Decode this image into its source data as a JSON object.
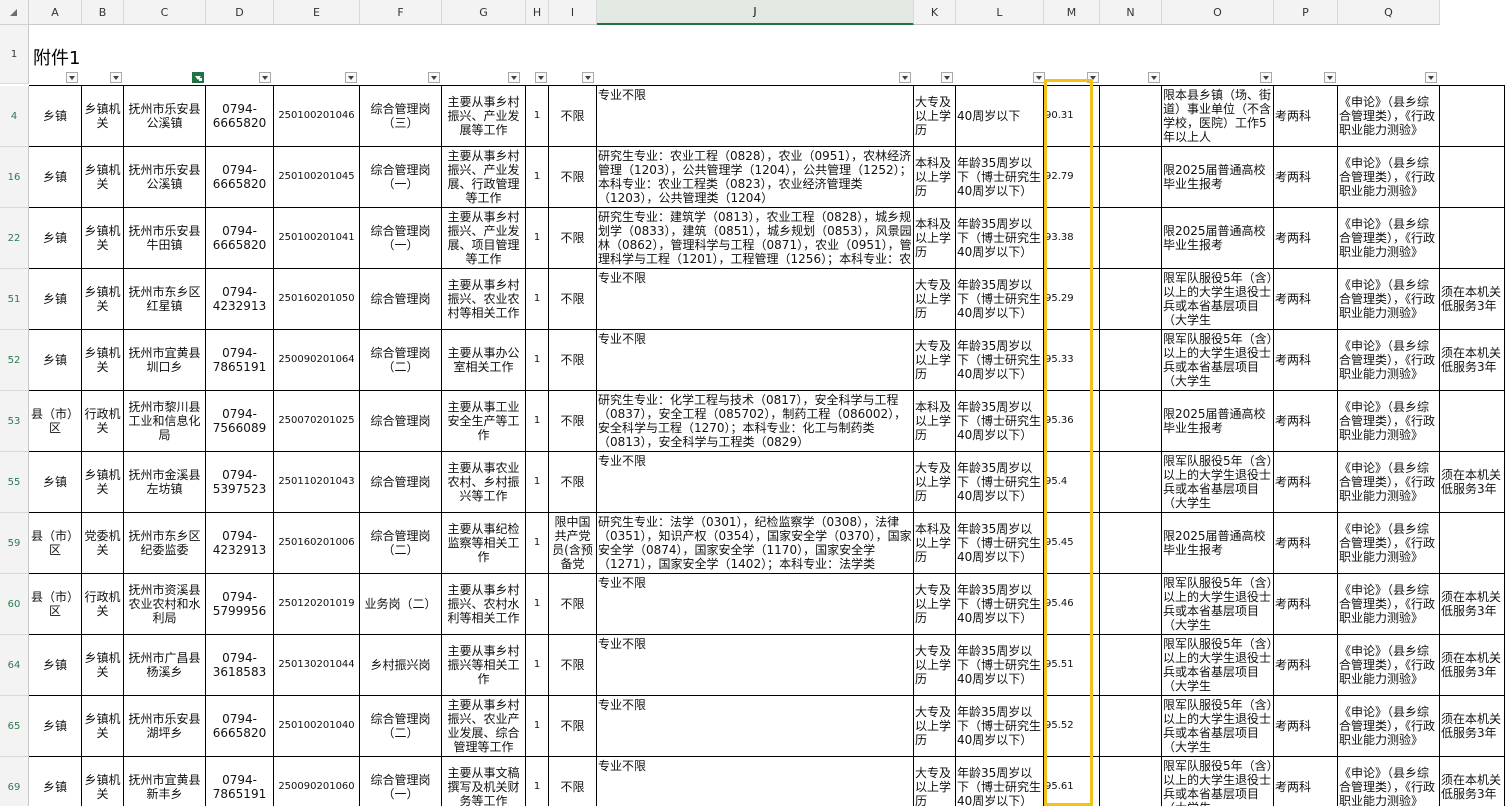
{
  "title": "附件1",
  "columns": [
    "A",
    "B",
    "C",
    "D",
    "E",
    "F",
    "G",
    "H",
    "I",
    "J",
    "K",
    "L",
    "M",
    "N",
    "O",
    "P",
    "Q"
  ],
  "rows": [
    {
      "num": "4",
      "level": "乡镇",
      "type": "乡镇机关",
      "unit": "抚州市乐安县公溪镇",
      "phone": "0794-6665820",
      "code": "250100201046",
      "post": "综合管理岗（三）",
      "duty": "主要从事乡村振兴、产业发展等工作",
      "count": "1",
      "politics": "不限",
      "major": "专业不限",
      "edu": "大专及以上学历",
      "age": "40周岁以下",
      "score": "90.31",
      "other": "限本县乡镇（场、街道）事业单位（不含学校，医院）工作5年以上人",
      "exam": "考两科",
      "subj": "《申论》（县乡综合管理类），《行政职业能力测验》",
      "note": ""
    },
    {
      "num": "16",
      "level": "乡镇",
      "type": "乡镇机关",
      "unit": "抚州市乐安县公溪镇",
      "phone": "0794-6665820",
      "code": "250100201045",
      "post": "综合管理岗（一）",
      "duty": "主要从事乡村振兴、产业发展、行政管理等工作",
      "count": "1",
      "politics": "不限",
      "major": "研究生专业：农业工程（0828），农业（0951），农林经济管理（1203），公共管理学（1204），公共管理（1252）；本科专业：农业工程类（0823），农业经济管理类（1203），公共管理类（1204）",
      "edu": "本科及以上学历",
      "age": "年龄35周岁以下（博士研究生40周岁以下）",
      "score": "92.79",
      "other": "限2025届普通高校毕业生报考",
      "exam": "考两科",
      "subj": "《申论》（县乡综合管理类），《行政职业能力测验》",
      "note": ""
    },
    {
      "num": "22",
      "level": "乡镇",
      "type": "乡镇机关",
      "unit": "抚州市乐安县牛田镇",
      "phone": "0794-6665820",
      "code": "250100201041",
      "post": "综合管理岗（一）",
      "duty": "主要从事乡村振兴、产业发展、项目管理等工作",
      "count": "1",
      "politics": "不限",
      "major": "研究生专业：建筑学（0813），农业工程（0828），城乡规划学（0833），建筑（0851），城乡规划（0853），风景园林（0862），管理科学与工程（0871），农业（0951），管理科学与工程（1201），工程管理（1256）；本科专业：农",
      "edu": "本科及以上学历",
      "age": "年龄35周岁以下（博士研究生40周岁以下）",
      "score": "93.38",
      "other": "限2025届普通高校毕业生报考",
      "exam": "考两科",
      "subj": "《申论》（县乡综合管理类），《行政职业能力测验》",
      "note": ""
    },
    {
      "num": "51",
      "level": "乡镇",
      "type": "乡镇机关",
      "unit": "抚州市东乡区红星镇",
      "phone": "0794-4232913",
      "code": "250160201050",
      "post": "综合管理岗",
      "duty": "主要从事乡村振兴、农业农村等相关工作",
      "count": "1",
      "politics": "不限",
      "major": "专业不限",
      "edu": "大专及以上学历",
      "age": "年龄35周岁以下（博士研究生40周岁以下）",
      "score": "95.29",
      "other": "限军队服役5年（含）以上的大学生退役士兵或本省基层项目（大学生",
      "exam": "考两科",
      "subj": "《申论》（县乡综合管理类），《行政职业能力测验》",
      "note": "须在本机关低服务3年"
    },
    {
      "num": "52",
      "level": "乡镇",
      "type": "乡镇机关",
      "unit": "抚州市宜黄县圳口乡",
      "phone": "0794-7865191",
      "code": "250090201064",
      "post": "综合管理岗（二）",
      "duty": "主要从事办公室相关工作",
      "count": "1",
      "politics": "不限",
      "major": "专业不限",
      "edu": "大专及以上学历",
      "age": "年龄35周岁以下（博士研究生40周岁以下）",
      "score": "95.33",
      "other": "限军队服役5年（含）以上的大学生退役士兵或本省基层项目（大学生",
      "exam": "考两科",
      "subj": "《申论》（县乡综合管理类），《行政职业能力测验》",
      "note": "须在本机关低服务3年"
    },
    {
      "num": "53",
      "level": "县（市）区",
      "type": "行政机关",
      "unit": "抚州市黎川县工业和信息化局",
      "phone": "0794-7566089",
      "code": "250070201025",
      "post": "综合管理岗",
      "duty": "主要从事工业安全生产等工作",
      "count": "1",
      "politics": "不限",
      "major": "研究生专业：化学工程与技术（0817），安全科学与工程（0837），安全工程（085702），制药工程（086002），安全科学与工程（1270）；本科专业：化工与制药类（0813），安全科学与工程类（0829）",
      "edu": "本科及以上学历",
      "age": "年龄35周岁以下（博士研究生40周岁以下）",
      "score": "95.36",
      "other": "限2025届普通高校毕业生报考",
      "exam": "考两科",
      "subj": "《申论》（县乡综合管理类），《行政职业能力测验》",
      "note": ""
    },
    {
      "num": "55",
      "level": "乡镇",
      "type": "乡镇机关",
      "unit": "抚州市金溪县左坊镇",
      "phone": "0794-5397523",
      "code": "250110201043",
      "post": "综合管理岗",
      "duty": "主要从事农业农村、乡村振兴等工作",
      "count": "1",
      "politics": "不限",
      "major": "专业不限",
      "edu": "大专及以上学历",
      "age": "年龄35周岁以下（博士研究生40周岁以下）",
      "score": "95.4",
      "other": "限军队服役5年（含）以上的大学生退役士兵或本省基层项目（大学生",
      "exam": "考两科",
      "subj": "《申论》（县乡综合管理类），《行政职业能力测验》",
      "note": "须在本机关低服务3年"
    },
    {
      "num": "59",
      "level": "县（市）区",
      "type": "党委机关",
      "unit": "抚州市东乡区纪委监委",
      "phone": "0794-4232913",
      "code": "250160201006",
      "post": "综合管理岗（二）",
      "duty": "主要从事纪检监察等相关工作",
      "count": "1",
      "politics": "限中国共产党员(含预备党",
      "major": "研究生专业：法学（0301），纪检监察学（0308），法律（0351），知识产权（0354），国家安全学（0370），国家安全学（0874），国家安全学（1170），国家安全学（1271），国家安全学（1402）；本科专业：法学类",
      "edu": "本科及以上学历",
      "age": "年龄35周岁以下（博士研究生40周岁以下）",
      "score": "95.45",
      "other": "限2025届普通高校毕业生报考",
      "exam": "考两科",
      "subj": "《申论》（县乡综合管理类），《行政职业能力测验》",
      "note": ""
    },
    {
      "num": "60",
      "level": "县（市）区",
      "type": "行政机关",
      "unit": "抚州市资溪县农业农村和水利局",
      "phone": "0794-5799956",
      "code": "250120201019",
      "post": "业务岗（二）",
      "duty": "主要从事乡村振兴、农村水利等相关工作",
      "count": "1",
      "politics": "不限",
      "major": "专业不限",
      "edu": "大专及以上学历",
      "age": "年龄35周岁以下（博士研究生40周岁以下）",
      "score": "95.46",
      "other": "限军队服役5年（含）以上的大学生退役士兵或本省基层项目（大学生",
      "exam": "考两科",
      "subj": "《申论》（县乡综合管理类），《行政职业能力测验》",
      "note": "须在本机关低服务3年"
    },
    {
      "num": "64",
      "level": "乡镇",
      "type": "乡镇机关",
      "unit": "抚州市广昌县杨溪乡",
      "phone": "0794-3618583",
      "code": "250130201044",
      "post": "乡村振兴岗",
      "duty": "主要从事乡村振兴等相关工作",
      "count": "1",
      "politics": "不限",
      "major": "专业不限",
      "edu": "大专及以上学历",
      "age": "年龄35周岁以下（博士研究生40周岁以下）",
      "score": "95.51",
      "other": "限军队服役5年（含）以上的大学生退役士兵或本省基层项目（大学生",
      "exam": "考两科",
      "subj": "《申论》（县乡综合管理类），《行政职业能力测验》",
      "note": "须在本机关低服务3年"
    },
    {
      "num": "65",
      "level": "乡镇",
      "type": "乡镇机关",
      "unit": "抚州市乐安县湖坪乡",
      "phone": "0794-6665820",
      "code": "250100201040",
      "post": "综合管理岗（二）",
      "duty": "主要从事乡村振兴、农业产业发展、综合管理等工作",
      "count": "1",
      "politics": "不限",
      "major": "专业不限",
      "edu": "大专及以上学历",
      "age": "年龄35周岁以下（博士研究生40周岁以下）",
      "score": "95.52",
      "other": "限军队服役5年（含）以上的大学生退役士兵或本省基层项目（大学生",
      "exam": "考两科",
      "subj": "《申论》（县乡综合管理类），《行政职业能力测验》",
      "note": "须在本机关低服务3年"
    },
    {
      "num": "69",
      "level": "乡镇",
      "type": "乡镇机关",
      "unit": "抚州市宜黄县新丰乡",
      "phone": "0794-7865191",
      "code": "250090201060",
      "post": "综合管理岗（一）",
      "duty": "主要从事文稿撰写及机关财务等工作",
      "count": "1",
      "politics": "不限",
      "major": "专业不限",
      "edu": "大专及以上学历",
      "age": "年龄35周岁以下（博士研究生40周岁以下）",
      "score": "95.61",
      "other": "限军队服役5年（含）以上的大学生退役士兵或本省基层项目（大学生",
      "exam": "考两科",
      "subj": "《申论》（县乡综合管理类），《行政职业能力测验》",
      "note": "须在本机关低服务3年"
    }
  ]
}
